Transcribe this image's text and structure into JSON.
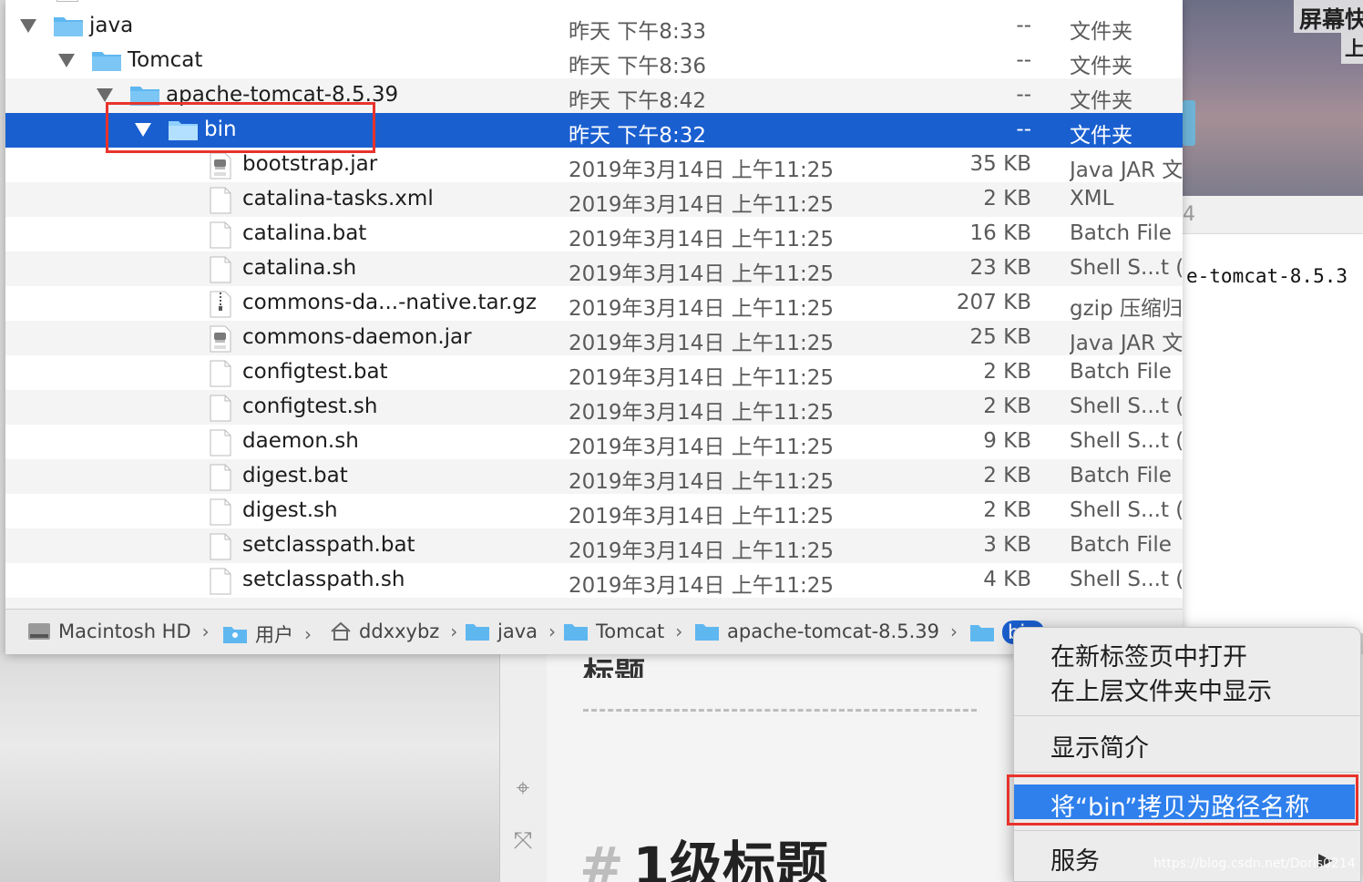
{
  "background": {
    "right_label_top": "屏幕快",
    "right_label_second": "上",
    "right_strip_text": "4",
    "right_mono_text": "e-tomcat-8.5.3",
    "editor_heading_cut": "标题",
    "editor_h1_hash": "#",
    "editor_h1_text": "1级标题"
  },
  "finder": {
    "rows": [
      {
        "name": "java",
        "date": "昨天 下午8:33",
        "size": "--",
        "kind": "文件夹"
      },
      {
        "name": "Tomcat",
        "date": "昨天 下午8:36",
        "size": "--",
        "kind": "文件夹"
      },
      {
        "name": "apache-tomcat-8.5.39",
        "date": "昨天 下午8:42",
        "size": "--",
        "kind": "文件夹"
      },
      {
        "name": "bin",
        "date": "昨天 下午8:32",
        "size": "--",
        "kind": "文件夹"
      },
      {
        "name": "bootstrap.jar",
        "date": "2019年3月14日 上午11:25",
        "size": "35 KB",
        "kind": "Java JAR 文"
      },
      {
        "name": "catalina-tasks.xml",
        "date": "2019年3月14日 上午11:25",
        "size": "2 KB",
        "kind": "XML"
      },
      {
        "name": "catalina.bat",
        "date": "2019年3月14日 上午11:25",
        "size": "16 KB",
        "kind": "Batch File"
      },
      {
        "name": "catalina.sh",
        "date": "2019年3月14日 上午11:25",
        "size": "23 KB",
        "kind": "Shell S...t (I"
      },
      {
        "name": "commons-da...-native.tar.gz",
        "date": "2019年3月14日 上午11:25",
        "size": "207 KB",
        "kind": "gzip 压缩归"
      },
      {
        "name": "commons-daemon.jar",
        "date": "2019年3月14日 上午11:25",
        "size": "25 KB",
        "kind": "Java JAR 文"
      },
      {
        "name": "configtest.bat",
        "date": "2019年3月14日 上午11:25",
        "size": "2 KB",
        "kind": "Batch File"
      },
      {
        "name": "configtest.sh",
        "date": "2019年3月14日 上午11:25",
        "size": "2 KB",
        "kind": "Shell S...t (I"
      },
      {
        "name": "daemon.sh",
        "date": "2019年3月14日 上午11:25",
        "size": "9 KB",
        "kind": "Shell S...t (I"
      },
      {
        "name": "digest.bat",
        "date": "2019年3月14日 上午11:25",
        "size": "2 KB",
        "kind": "Batch File"
      },
      {
        "name": "digest.sh",
        "date": "2019年3月14日 上午11:25",
        "size": "2 KB",
        "kind": "Shell S...t (I"
      },
      {
        "name": "setclasspath.bat",
        "date": "2019年3月14日 上午11:25",
        "size": "3 KB",
        "kind": "Batch File"
      },
      {
        "name": "setclasspath.sh",
        "date": "2019年3月14日 上午11:25",
        "size": "4 KB",
        "kind": "Shell S...t (I"
      }
    ],
    "pathbar": {
      "disk": "Macintosh HD",
      "users": "用户",
      "home": "ddxxybz",
      "java": "java",
      "tomcat": "Tomcat",
      "apache": "apache-tomcat-8.5.39",
      "current": "bin"
    }
  },
  "context_menu": {
    "open_new_tab": "在新标签页中打开",
    "show_in_parent": "在上层文件夹中显示",
    "get_info": "显示简介",
    "copy_path": "将“bin”拷贝为路径名称",
    "services": "服务"
  },
  "watermark": "https://blog.csdn.net/Doris0214",
  "colors": {
    "selection": "#1a5fd0",
    "menu_selection": "#2f80ec",
    "highlight_box": "#e8332c",
    "folder": "#5fb7f0"
  }
}
